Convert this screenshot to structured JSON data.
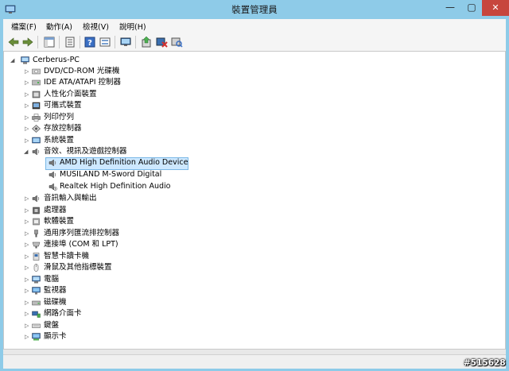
{
  "window": {
    "title": "裝置管理員",
    "controls": {
      "minimize": "—",
      "maximize": "▢",
      "close": "✕"
    }
  },
  "menu": {
    "file": "檔案(F)",
    "action": "動作(A)",
    "view": "檢視(V)",
    "help": "說明(H)"
  },
  "toolbar": {
    "icons": [
      "back-arrow-icon",
      "forward-arrow-icon",
      "show-hide-tree-icon",
      "properties-icon",
      "help-icon",
      "view-icon",
      "monitor-icon",
      "update-driver-icon",
      "uninstall-icon",
      "scan-hardware-icon"
    ]
  },
  "tree": {
    "root": "Cerberus-PC",
    "items": [
      {
        "label": "DVD/CD-ROM 光碟機"
      },
      {
        "label": "IDE ATA/ATAPI 控制器"
      },
      {
        "label": "人性化介面裝置"
      },
      {
        "label": "可攜式裝置"
      },
      {
        "label": "列印佇列"
      },
      {
        "label": "存放控制器"
      },
      {
        "label": "系統裝置"
      },
      {
        "label": "音效、視訊及遊戲控制器",
        "expanded": true,
        "children": [
          {
            "label": "AMD High Definition Audio Device",
            "selected": true
          },
          {
            "label": "MUSILAND M-Sword Digital"
          },
          {
            "label": "Realtek High Definition Audio"
          }
        ]
      },
      {
        "label": "音訊輸入與輸出"
      },
      {
        "label": "處理器"
      },
      {
        "label": "軟體裝置"
      },
      {
        "label": "通用序列匯流排控制器"
      },
      {
        "label": "連接埠 (COM 和 LPT)"
      },
      {
        "label": "智慧卡讀卡機"
      },
      {
        "label": "滑鼠及其他指標裝置"
      },
      {
        "label": "電腦"
      },
      {
        "label": "監視器"
      },
      {
        "label": "磁碟機"
      },
      {
        "label": "網路介面卡"
      },
      {
        "label": "鍵盤"
      },
      {
        "label": "顯示卡"
      }
    ]
  },
  "watermark": "#515628"
}
